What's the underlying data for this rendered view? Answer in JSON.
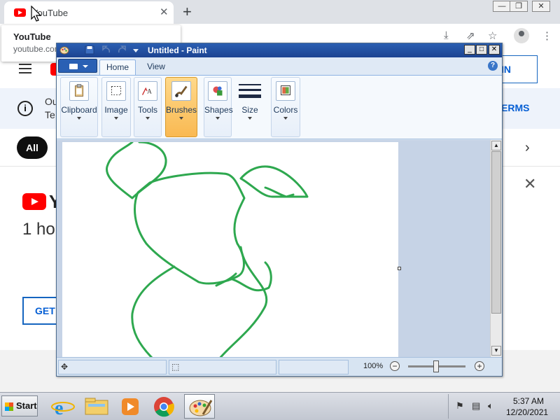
{
  "browser": {
    "tab_title": "YouTube",
    "tab_close": "✕",
    "new_tab": "+",
    "window_controls": [
      "—",
      "❐",
      "✕"
    ],
    "toolbar_icons": [
      "download-icon",
      "share-icon",
      "star-icon",
      "avatar",
      "kebab-menu-icon"
    ],
    "tooltip": {
      "title": "YouTube",
      "url": "youtube.com"
    }
  },
  "page": {
    "sign_in_label": "IN",
    "notice_line1": "Ou",
    "notice_line2": "Te",
    "terms_label": "ERMS",
    "chip_all": "All",
    "promo_logo_text": "Y",
    "promo_headline": "1 hou",
    "get_button": "GET"
  },
  "paint": {
    "title": "Untitled - Paint",
    "tabs": [
      {
        "label": "Home",
        "active": true
      },
      {
        "label": "View",
        "active": false
      }
    ],
    "help": "?",
    "groups": [
      {
        "label": "Clipboard",
        "icon": "clipboard-icon"
      },
      {
        "label": "Image",
        "icon": "select-icon"
      },
      {
        "label": "Tools",
        "icon": "tools-icon"
      },
      {
        "label": "Brushes",
        "icon": "brush-icon",
        "selected": true
      },
      {
        "label": "Shapes",
        "icon": "shapes-icon"
      },
      {
        "label": "Size",
        "icon": "size-icon"
      },
      {
        "label": "Colors",
        "icon": "colors-icon"
      }
    ],
    "stroke_color": "#2ea84f",
    "zoom": "100%",
    "zoom_minus": "−",
    "zoom_plus": "+"
  },
  "taskbar": {
    "start_label": "Start",
    "apps": [
      "internet-explorer-icon",
      "file-explorer-icon",
      "media-player-icon",
      "chrome-icon",
      "paint-icon"
    ],
    "tray_icons": [
      "action-center-icon",
      "network-icon",
      "volume-icon"
    ],
    "time": "5:37 AM",
    "date": "12/20/2021"
  }
}
